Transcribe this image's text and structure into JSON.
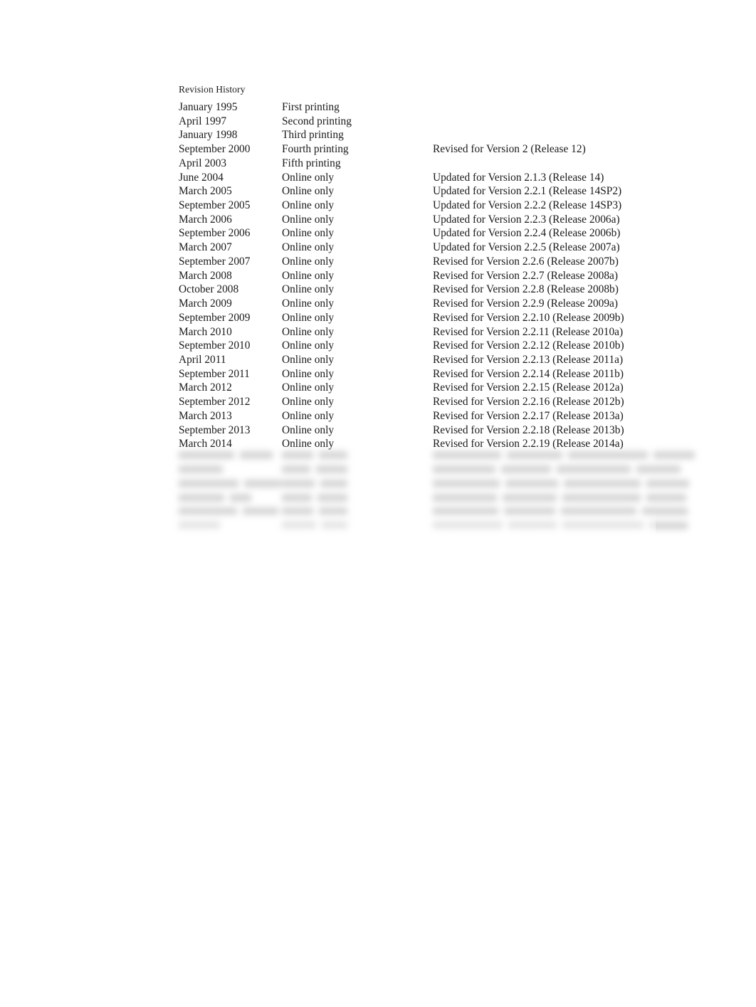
{
  "document": {
    "heading": "Revision History",
    "background_color": "#ffffff",
    "text_color": "#1a1a1a"
  },
  "table": {
    "columns": [
      "date",
      "printing",
      "description"
    ],
    "rows": [
      {
        "date": "January 1995",
        "printing": "First printing",
        "description": ""
      },
      {
        "date": "April 1997",
        "printing": "Second printing",
        "description": ""
      },
      {
        "date": "January 1998",
        "printing": "Third printing",
        "description": ""
      },
      {
        "date": "September 2000",
        "printing": "Fourth printing",
        "description": "Revised for Version 2 (Release 12)"
      },
      {
        "date": "April 2003",
        "printing": "Fifth printing",
        "description": ""
      },
      {
        "date": "June 2004",
        "printing": "Online only",
        "description": "Updated for Version 2.1.3 (Release 14)"
      },
      {
        "date": "March 2005",
        "printing": "Online only",
        "description": "Updated for Version 2.2.1 (Release 14SP2)"
      },
      {
        "date": "September 2005",
        "printing": "Online only",
        "description": "Updated for Version 2.2.2 (Release 14SP3)"
      },
      {
        "date": "March 2006",
        "printing": "Online only",
        "description": "Updated for Version 2.2.3 (Release 2006a)"
      },
      {
        "date": "September 2006",
        "printing": "Online only",
        "description": "Updated for Version 2.2.4 (Release 2006b)"
      },
      {
        "date": "March 2007",
        "printing": "Online only",
        "description": "Updated for Version 2.2.5 (Release 2007a)"
      },
      {
        "date": "September 2007",
        "printing": "Online only",
        "description": "Revised for Version 2.2.6 (Release 2007b)"
      },
      {
        "date": "March 2008",
        "printing": "Online only",
        "description": "Revised for Version 2.2.7 (Release 2008a)"
      },
      {
        "date": "October 2008",
        "printing": "Online only",
        "description": "Revised for Version 2.2.8 (Release 2008b)"
      },
      {
        "date": "March 2009",
        "printing": "Online only",
        "description": "Revised for Version 2.2.9 (Release 2009a)"
      },
      {
        "date": "September 2009",
        "printing": "Online only",
        "description": "Revised for Version 2.2.10 (Release 2009b)"
      },
      {
        "date": "March 2010",
        "printing": "Online only",
        "description": "Revised for Version 2.2.11 (Release 2010a)"
      },
      {
        "date": "September 2010",
        "printing": "Online only",
        "description": "Revised for Version 2.2.12 (Release 2010b)"
      },
      {
        "date": "April 2011",
        "printing": "Online only",
        "description": "Revised for Version 2.2.13 (Release 2011a)"
      },
      {
        "date": "September 2011",
        "printing": "Online only",
        "description": "Revised for Version 2.2.14 (Release 2011b)"
      },
      {
        "date": "March 2012",
        "printing": "Online only",
        "description": "Revised for Version 2.2.15 (Release 2012a)"
      },
      {
        "date": "September 2012",
        "printing": "Online only",
        "description": "Revised for Version 2.2.16 (Release 2012b)"
      },
      {
        "date": "March 2013",
        "printing": "Online only",
        "description": "Revised for Version 2.2.17 (Release 2013a)"
      },
      {
        "date": "September 2013",
        "printing": "Online only",
        "description": "Revised for Version 2.2.18 (Release 2013b)"
      },
      {
        "date": "March 2014",
        "printing": "Online only",
        "description": "Revised for Version 2.2.19 (Release 2014a)"
      }
    ]
  },
  "redacted": {
    "note": "trailing rows are blurred and illegible in the source image",
    "row_count": 6,
    "shade_color": "#9a9a9a",
    "rows": [
      {
        "date_w": [
          78,
          46
        ],
        "printing_w": [
          44,
          40
        ],
        "description_w": [
          96,
          78,
          112,
          58
        ]
      },
      {
        "date_w": [
          62
        ],
        "printing_w": [
          40,
          44
        ],
        "description_w": [
          88,
          70,
          104,
          62
        ]
      },
      {
        "date_w": [
          84,
          52
        ],
        "printing_w": [
          46,
          38
        ],
        "description_w": [
          94,
          74,
          108,
          60
        ]
      },
      {
        "date_w": [
          64,
          30
        ],
        "printing_w": [
          42,
          42
        ],
        "description_w": [
          90,
          76,
          110,
          56
        ]
      },
      {
        "date_w": [
          82,
          50
        ],
        "printing_w": [
          44,
          40
        ],
        "description_w": [
          92,
          72,
          106,
          64
        ]
      },
      {
        "date_w": [
          58
        ],
        "printing_w": [
          48,
          36
        ],
        "description_w": [
          98,
          68,
          114,
          54
        ]
      }
    ]
  }
}
